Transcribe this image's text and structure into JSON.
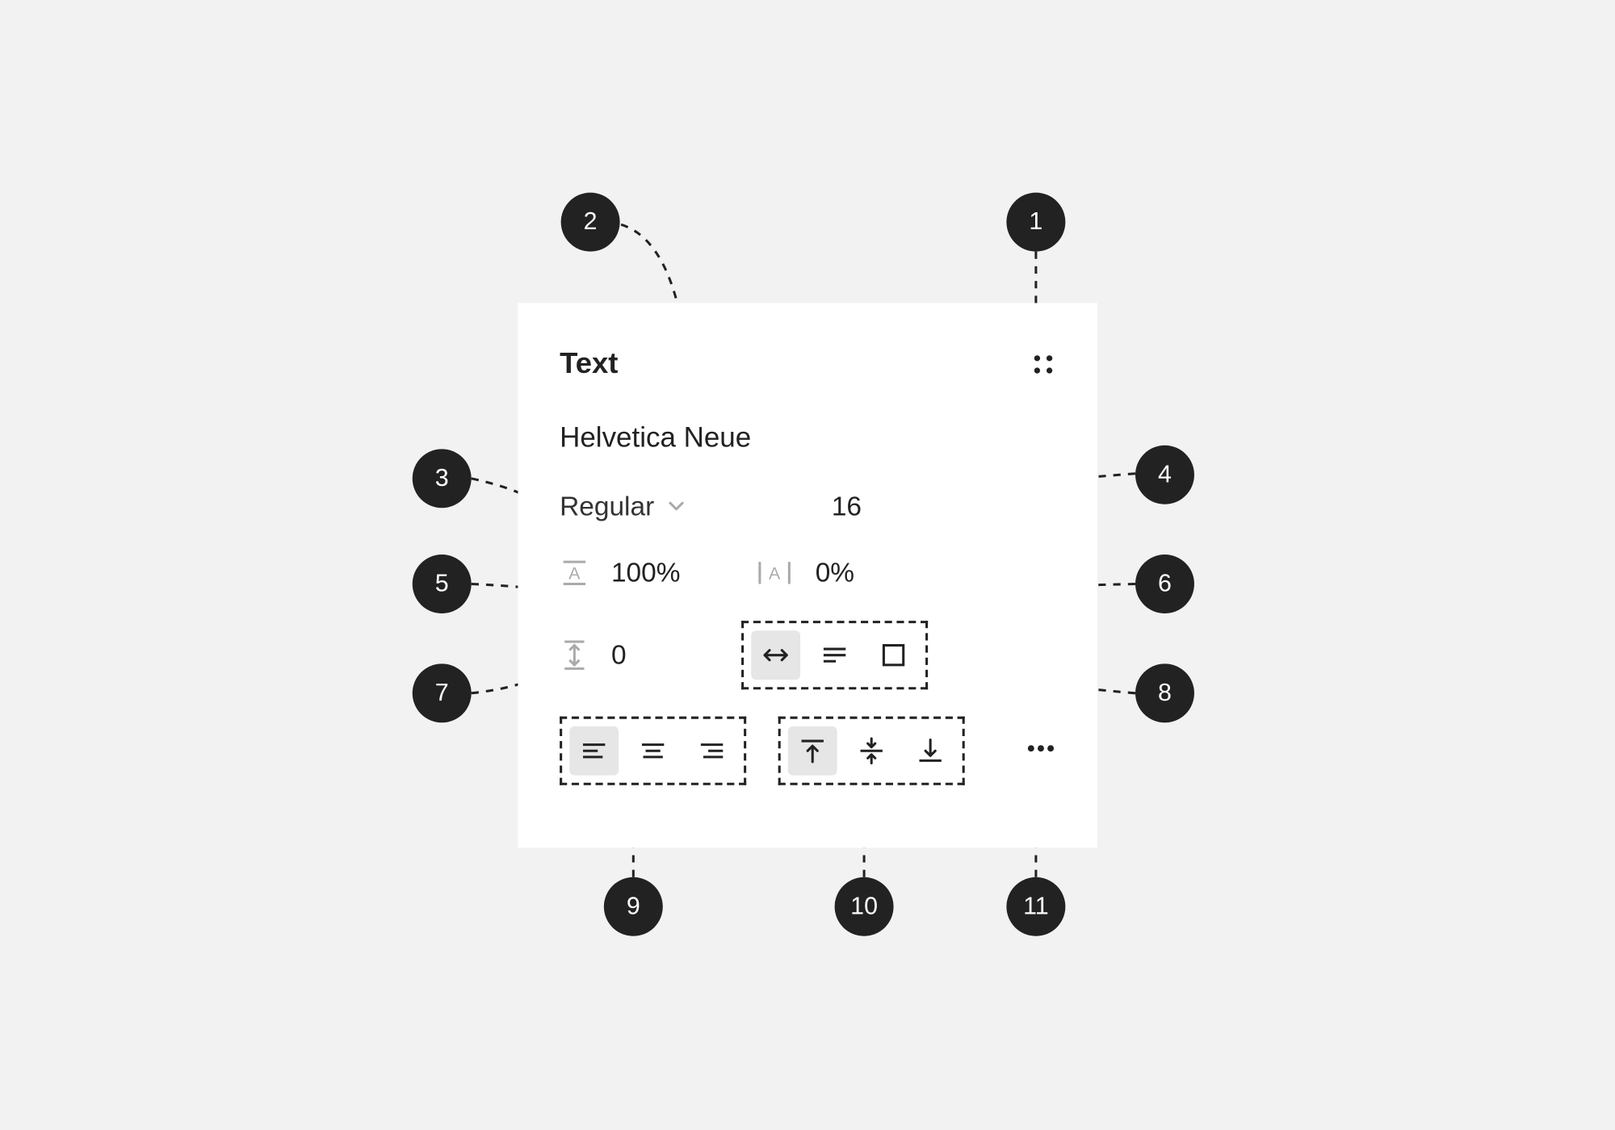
{
  "panel": {
    "title": "Text",
    "font_family": "Helvetica Neue",
    "font_weight": "Regular",
    "font_size": "16",
    "line_height": "100%",
    "letter_spacing": "0%",
    "paragraph_spacing": "0"
  },
  "callouts": {
    "c1": "1",
    "c2": "2",
    "c3": "3",
    "c4": "4",
    "c5": "5",
    "c6": "6",
    "c7": "7",
    "c8": "8",
    "c9": "9",
    "c10": "10",
    "c11": "11"
  }
}
